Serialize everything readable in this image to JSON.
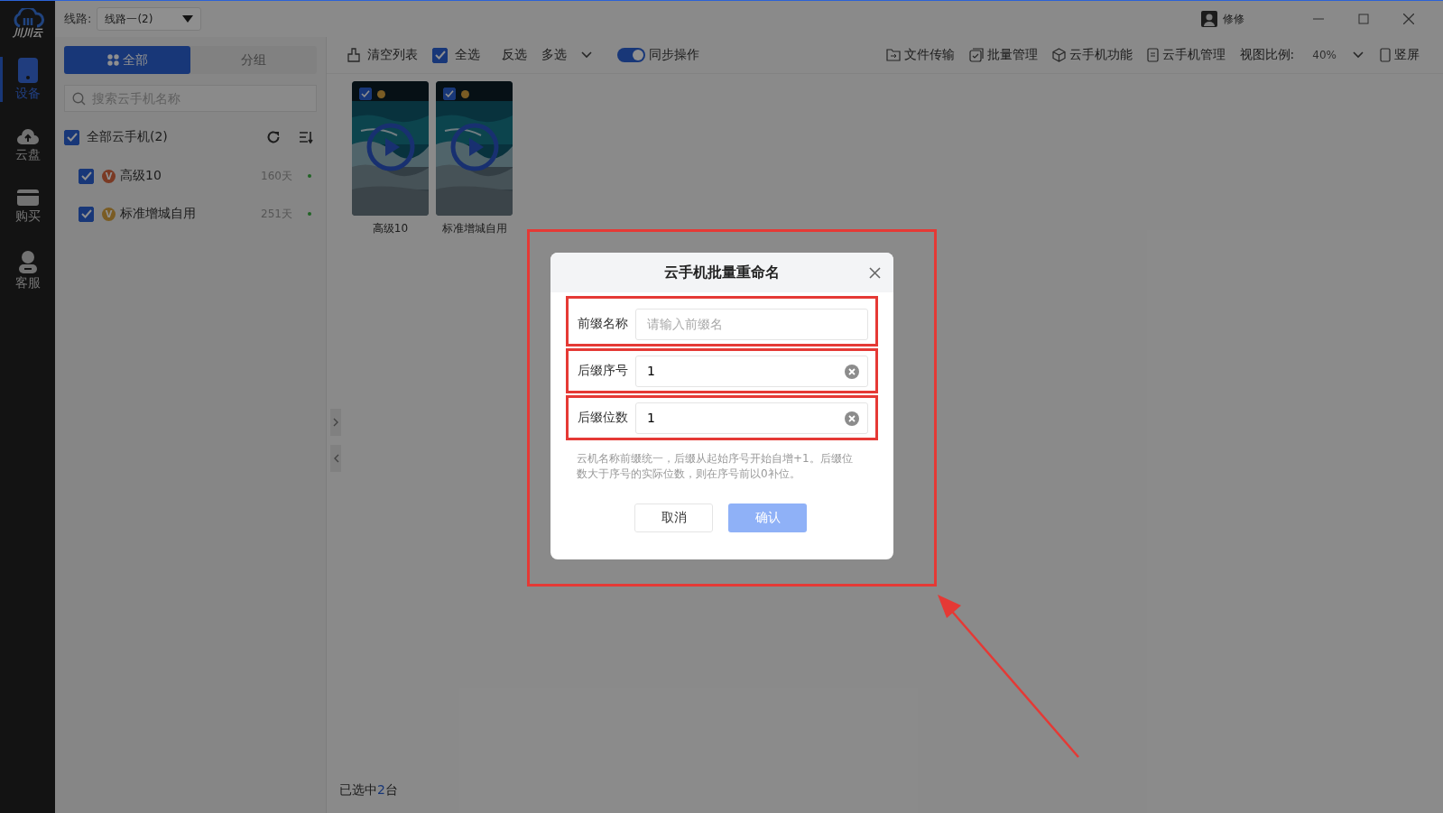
{
  "titlebar": {
    "logo_text": "川川云",
    "route_label": "线路:",
    "route_value": "线路一(2)",
    "user": "修修"
  },
  "nav": [
    {
      "label": "设备",
      "selected": true
    },
    {
      "label": "云盘",
      "selected": false
    },
    {
      "label": "购买",
      "selected": false
    },
    {
      "label": "客服",
      "selected": false
    }
  ],
  "left_panel": {
    "tabs": [
      {
        "label": "全部",
        "selected": true
      },
      {
        "label": "分组",
        "selected": false
      }
    ],
    "search": {
      "placeholder": "搜索云手机名称"
    },
    "all": {
      "label": "全部云手机(2)",
      "checked": true
    },
    "devices": [
      {
        "badge": "V",
        "color": "#7a3a24",
        "name": "高级10",
        "days": "160天",
        "checked": true,
        "online": true
      },
      {
        "badge": "V",
        "color": "#7a5c24",
        "name": "标准增城自用",
        "days": "251天",
        "checked": true,
        "online": true
      }
    ]
  },
  "toolbar": {
    "clear": "清空列表",
    "select_all": {
      "label": "全选",
      "checked": true
    },
    "invert": "反选",
    "multi": "多选",
    "sync": {
      "label": "同步操作",
      "on": true
    },
    "tools": [
      {
        "label": "文件传输"
      },
      {
        "label": "批量管理"
      },
      {
        "label": "云手机功能"
      },
      {
        "label": "云手机管理"
      }
    ],
    "zoom_label": "视图比例:",
    "zoom_value": "40%",
    "orientation": "竖屏"
  },
  "phones": [
    {
      "name": "高级10",
      "checked": true,
      "color": "#7a5c24"
    },
    {
      "name": "标准增城自用",
      "checked": true,
      "color": "#7a5c24"
    }
  ],
  "status": {
    "prefix": "已选中",
    "count": "2",
    "suffix": "台"
  },
  "dialog": {
    "title": "云手机批量重命名",
    "fields": [
      {
        "label": "前缀名称",
        "placeholder": "请输入前缀名"
      },
      {
        "label": "后缀序号",
        "value": "1"
      },
      {
        "label": "后缀位数",
        "value": "1"
      }
    ],
    "hint": "云机名称前缀统一，后缀从起始序号开始自增+1。后缀位数大于序号的实际位数，则在序号前以0补位。",
    "cancel": "取消",
    "confirm": {
      "label": "确认",
      "disabled": true
    }
  }
}
